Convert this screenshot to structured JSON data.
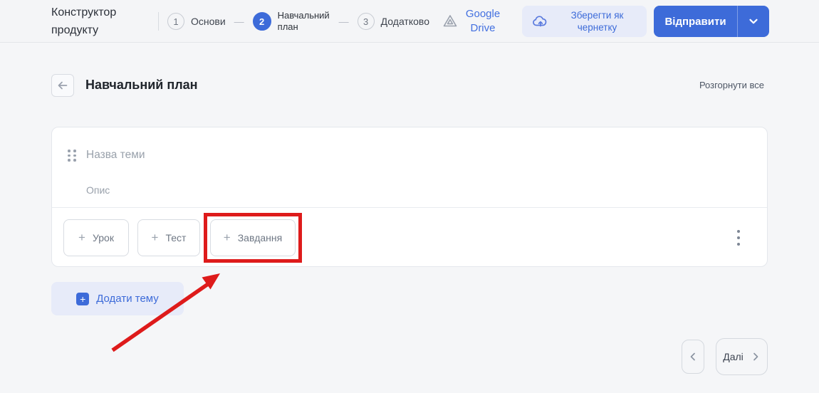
{
  "app": {
    "title": "Конструктор продукту"
  },
  "stepper": {
    "separator": "—",
    "steps": [
      {
        "num": "1",
        "label": "Основи",
        "state": "inactive"
      },
      {
        "num": "2",
        "label": "Навчальний план",
        "state": "active"
      },
      {
        "num": "3",
        "label": "Додатково",
        "state": "inactive"
      }
    ]
  },
  "header_actions": {
    "google_drive_label": "Google Drive",
    "save_draft_label": "Зберегти як чернетку",
    "submit_label": "Відправити"
  },
  "page": {
    "title": "Навчальний план",
    "expand_all_label": "Розгорнути все"
  },
  "topic_card": {
    "title_placeholder": "Назва теми",
    "description_placeholder": "Опис",
    "add_buttons": [
      {
        "label": "Урок",
        "highlighted": false
      },
      {
        "label": "Тест",
        "highlighted": false
      },
      {
        "label": "Завдання",
        "highlighted": true
      }
    ]
  },
  "add_topic_label": "Додати тему",
  "pagination": {
    "next_label": "Далі"
  },
  "icons": {
    "plus": "+"
  },
  "colors": {
    "primary_blue": "#3d6bd9",
    "lavender_bg": "#e7ebf9",
    "annotation_red": "#de1b1b",
    "page_bg": "#f5f6f8"
  }
}
